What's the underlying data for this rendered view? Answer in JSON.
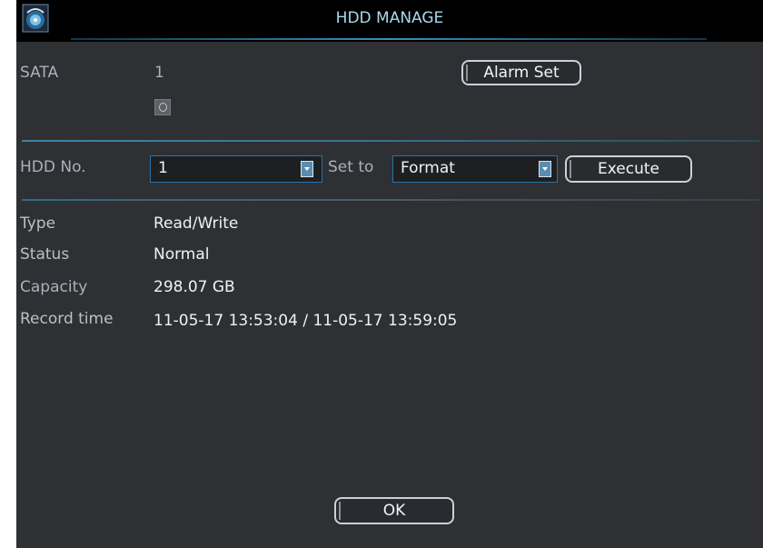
{
  "window": {
    "title": "HDD MANAGE",
    "icon": "app-logo-icon"
  },
  "sata": {
    "label": "SATA",
    "value": "1",
    "alarm_button": "Alarm Set"
  },
  "controls": {
    "hdd_label": "HDD No.",
    "hdd_value": "1",
    "set_to_label": "Set to",
    "set_to_value": "Format",
    "execute_button": "Execute"
  },
  "info": {
    "type_label": "Type",
    "type_value": "Read/Write",
    "status_label": "Status",
    "status_value": "Normal",
    "capacity_label": "Capacity",
    "capacity_value": "298.07 GB",
    "record_label": "Record time",
    "record_value": "11-05-17 13:53:04 / 11-05-17 13:59:05"
  },
  "footer": {
    "ok_button": "OK"
  },
  "colors": {
    "background": "#2f3033",
    "titlebar": "#000000",
    "title_text": "#a8d8ee",
    "accent": "#2a72a8"
  }
}
